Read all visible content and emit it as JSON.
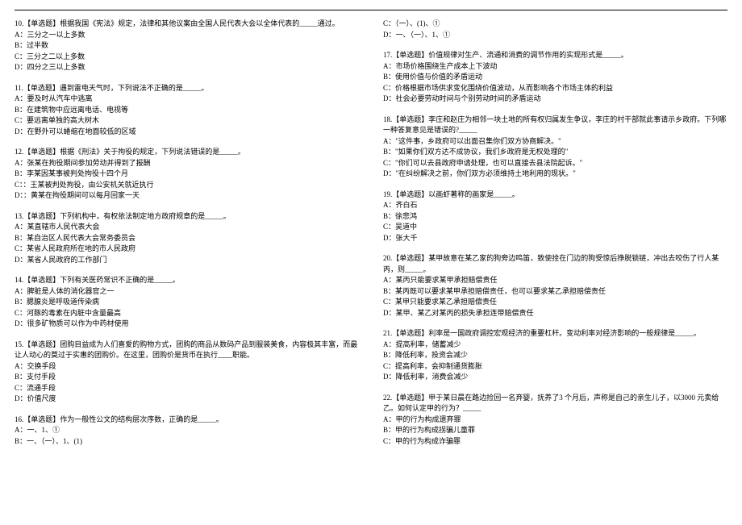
{
  "left": [
    {
      "q": "10.【单选题】根据我国《宪法》规定，法律和其他议案由全国人民代表大会以全体代表的_____通过。",
      "opts": [
        "A：三分之一以上多数",
        "B：过半数",
        "C：三分之二以上多数",
        "D：四分之三以上多数"
      ]
    },
    {
      "q": "11.【单选题】遇到雷电天气时，下列说法不正确的是_____。",
      "opts": [
        "A：要及时从汽车中逃离",
        "B：在建筑物中应远离电话、电视等",
        "C：要远离单独的高大树木",
        "D：在野外可以蜷缩在地面较低的区域"
      ]
    },
    {
      "q": "12.【单选题】根据《刑法》关于拘役的规定，下列说法错误的是_____。",
      "opts": [
        "A：张某在拘役期间参加劳动并得到了报酬",
        "B：李某因某事被判处拘役十四个月",
        "C：：王某被判处拘役，由公安机关就近执行",
        "D：：黄某在拘役期间可以每月回家一天"
      ]
    },
    {
      "q": "13.【单选题】下列机构中，有权依法制定地方政府规章的是_____。",
      "opts": [
        "A：某直辖市人民代表大会",
        "B：某自治区人民代表大会常务委员会",
        "C：某省人民政府所在地的市人民政府",
        "D：某省人民政府的工作部门"
      ]
    },
    {
      "q": "14.【单选题】下列有关医药常识不正确的是_____。",
      "opts": [
        "A：脾脏是人体的消化器官之一",
        "B：腮腺炎是呼吸道传染病",
        "C：河豚的毒素在内脏中含量最高",
        "D：很多矿物质可以作为中药材使用"
      ]
    },
    {
      "q": "15.【单选题】团购目益成为人们喜爱的购物方式，团购的商品从数码产品到服装美食，内容极其丰富，而最让人动心的莫过于实惠的团购价。在这里，团购价是货币在执行____职能。",
      "opts": [
        "A：交换手段",
        "B：支付手段",
        "C：流通手段",
        "D：价值尺度"
      ]
    },
    {
      "q": "16.【单选题】作为一般性公文的结构层次序数，正确的是_____。",
      "opts": [
        "A：一、1、①",
        "B：一、（一）、1、(1)"
      ]
    }
  ],
  "right": [
    {
      "q": "",
      "opts": [
        "C：（一）、(1)、①",
        "D：一、（一）、1、①"
      ]
    },
    {
      "q": "17.【单选题】价值规律对生产、流通和消费的调节作用的实现形式是_____。",
      "opts": [
        "A：市场价格围绕生产成本上下波动",
        "B：使用价值与价值的矛盾运动",
        "C：价格根据市场供求变化围绕价值波动，从而影响各个市场主体的利益",
        "D：社会必要劳动时间与个别劳动时间的矛盾运动"
      ]
    },
    {
      "q": "18.【单选题】李庄和赵庄为相邻一块土地的所有权归属发生争议，李庄的村干部就此事请示乡政府。下列哪一种答复意见是错误的?_____",
      "opts": [
        "A：\"这件事，乡政府可以出面召集你们双方协商解决。\"",
        "B：\"如果你们双方达不成协议，我们乡政府是无权处理的\"",
        "C：\"你们可以去县政府申请处理，也可以直接去县法院起诉。\"",
        "D：\"在纠纷解决之前，你们双方必须维持土地利用的现状。\""
      ]
    },
    {
      "q": "19.【单选题】以画虾著称的画家是_____。",
      "opts": [
        "A：齐白石",
        "B：徐悲鸿",
        "C：吴道中",
        "D：张大千"
      ]
    },
    {
      "q": "20.【单选题】某甲故意在某乙家的狗旁边鸣笛，致使拴在门边的狗受惊后挣脱锁链，冲出去咬伤了行人某丙，则_____。",
      "opts": [
        "A：某丙只能要求某甲承担赔偿责任",
        "B：某丙既可以要求某甲承担赔偿责任，也可以要求某乙承担赔偿责任",
        "C：某甲只能要求某乙承担赔偿责任",
        "D：某甲、某乙对某丙的损失承担连带赔偿责任"
      ]
    },
    {
      "q": "21.【单选题】利率是一国政府调控宏观经济的重要杠杆。变动利率对经济影响的一般规律是_____。",
      "opts": [
        "A：提高利率，储蓄减少",
        "B：降低利率，投资会减少",
        "C：提高利率，会抑制通货膨胀",
        "D：降低利率，消费会减少"
      ]
    },
    {
      "q": "22.【单选题】甲于某日晨在路边捡回一名弃婴，抚养了3 个月后，声称是自己的亲生儿子，以3000 元卖给乙。如何认定甲的行为？_____",
      "opts": [
        "A：甲的行为构成遗弃罪",
        "B：甲的行为构成拐骗儿童罪",
        "C：甲的行为构成诈骗罪"
      ]
    }
  ]
}
